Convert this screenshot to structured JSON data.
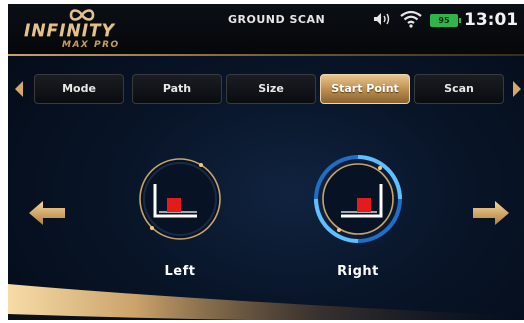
{
  "header": {
    "brand": "INFINITY",
    "brand_sub": "MAX PRO",
    "screen_title": "GROUND SCAN",
    "battery": "95",
    "clock": "13:01"
  },
  "tabs": [
    {
      "label": "Mode",
      "active": false
    },
    {
      "label": "Path",
      "active": false
    },
    {
      "label": "Size",
      "active": false
    },
    {
      "label": "Start Point",
      "active": true
    },
    {
      "label": "Scan",
      "active": false
    }
  ],
  "options": [
    {
      "label": "Left",
      "selected": false
    },
    {
      "label": "Right",
      "selected": true
    }
  ],
  "colors": {
    "gold": "#d4a865",
    "accent_blue": "#3fa7ff",
    "marker_red": "#e31b1b",
    "battery_green": "#2fb54a"
  }
}
